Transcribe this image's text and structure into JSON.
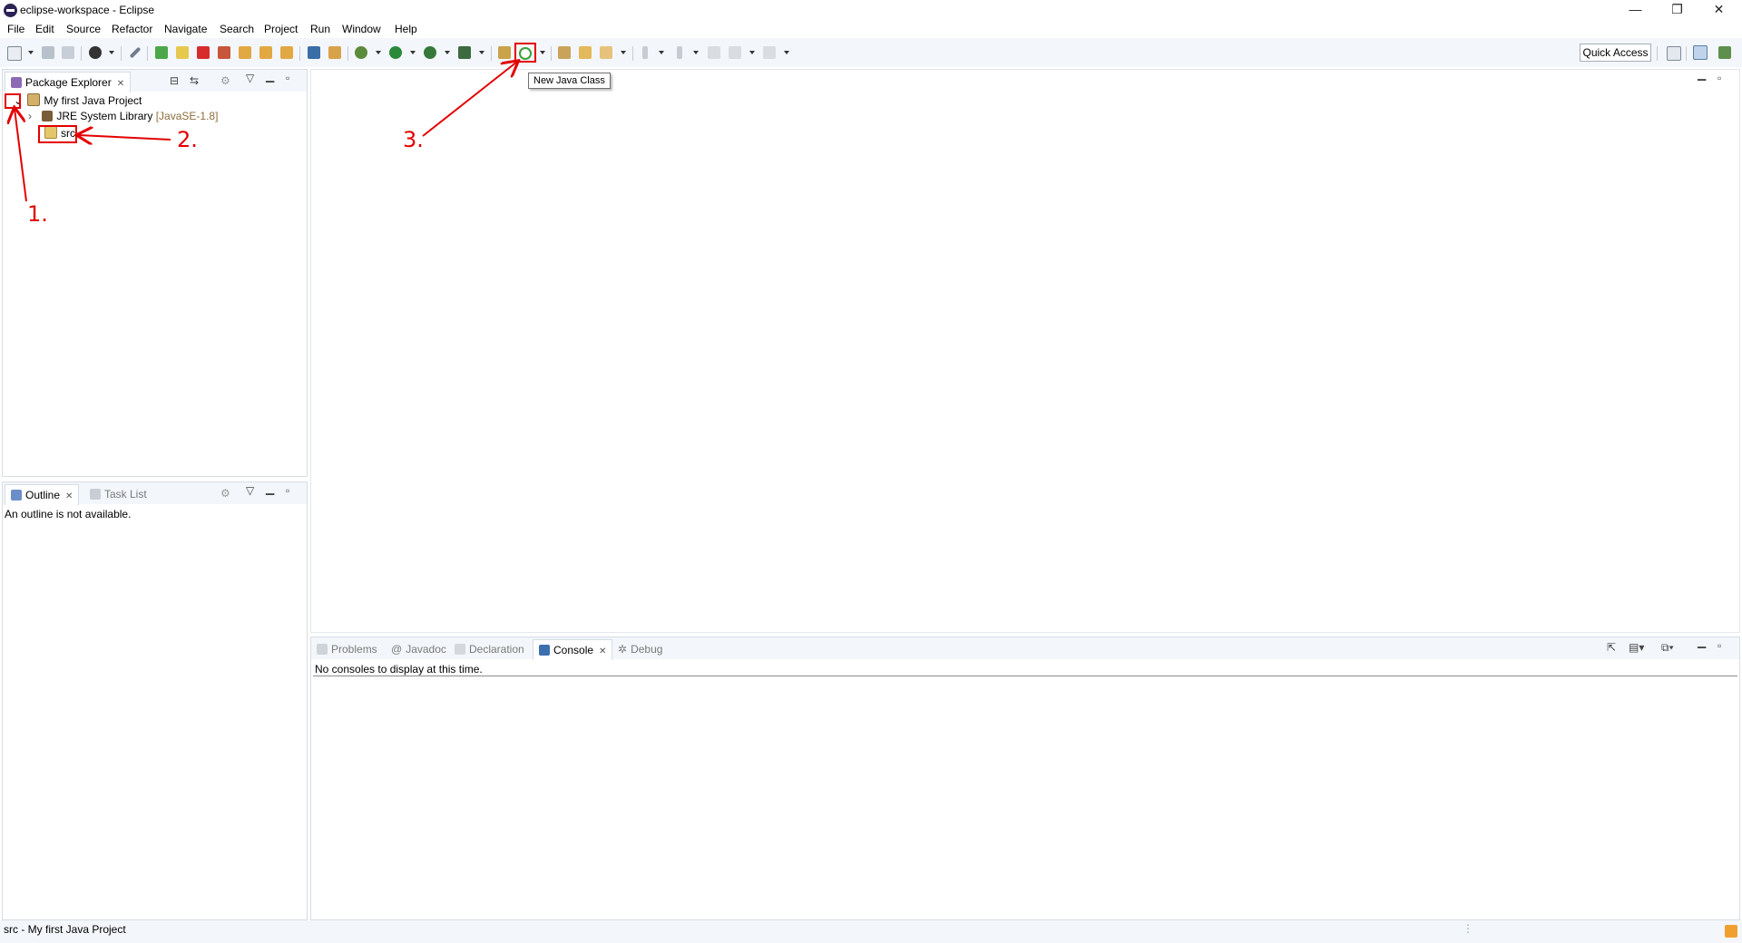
{
  "window": {
    "title": "eclipse-workspace - Eclipse",
    "min": "—",
    "restore": "❐",
    "close": "✕"
  },
  "menu": [
    "File",
    "Edit",
    "Source",
    "Refactor",
    "Navigate",
    "Search",
    "Project",
    "Run",
    "Window",
    "Help"
  ],
  "toolbar": {
    "quick_access": "Quick Access",
    "tooltip": "New Java Class"
  },
  "package_explorer": {
    "tab": "Package Explorer",
    "project": "My first Java Project",
    "jre": "JRE System Library",
    "jre_version": "[JavaSE-1.8]",
    "src": "src"
  },
  "outline": {
    "tab": "Outline",
    "task_tab": "Task List",
    "message": "An outline is not available."
  },
  "console_panel": {
    "tabs": [
      "Problems",
      "Javadoc",
      "Declaration",
      "Console",
      "Debug"
    ],
    "message": "No consoles to display at this time."
  },
  "status": {
    "text": "src - My first Java Project"
  },
  "annotations": [
    "1.",
    "2.",
    "3."
  ],
  "colors": {
    "annotation": "#e30000",
    "chrome": "#f3f6fa",
    "border": "#d7dde5"
  }
}
